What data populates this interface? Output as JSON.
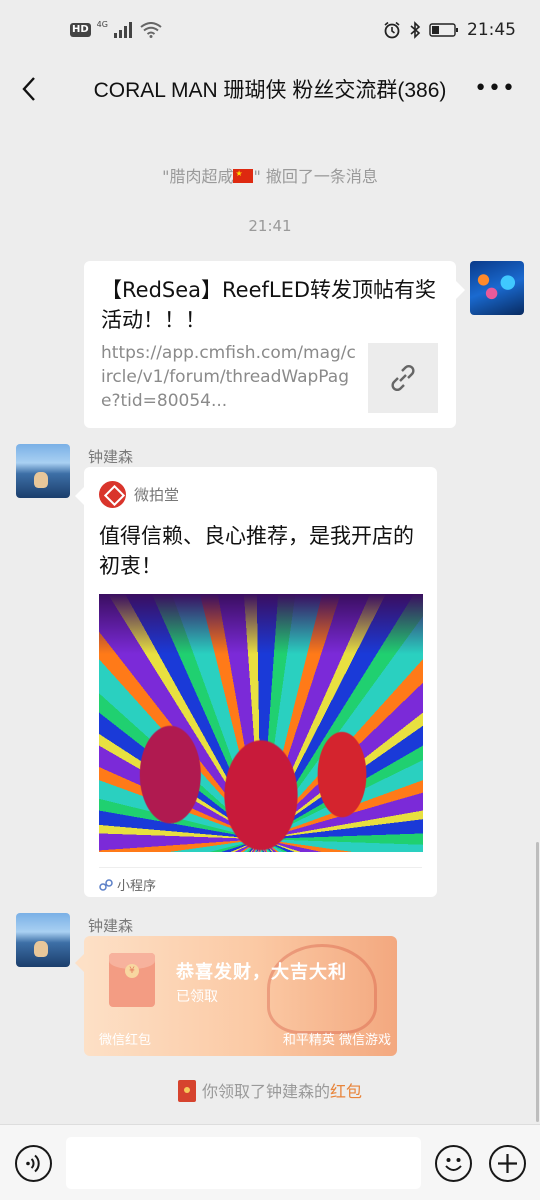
{
  "status_bar": {
    "hd": "HD",
    "network": "4G",
    "time": "21:45"
  },
  "header": {
    "title": "CORAL MAN 珊瑚侠 粉丝交流群(386)",
    "more": "•••"
  },
  "messages": {
    "recall_notice_prefix": "\"腊肉超咸",
    "recall_notice_suffix": "\" 撤回了一条消息",
    "timestamp": "21:41",
    "link_share": {
      "title": "【RedSea】ReefLED转发顶帖有奖活动！！！",
      "url": "https://app.cmfish.com/mag/circle/v1/forum/threadWapPage?tid=80054..."
    },
    "sender_1": "钟建森",
    "mini_program": {
      "app_name": "微拍堂",
      "text": "值得信赖、良心推荐，是我开店的初衷！",
      "footer": "小程序"
    },
    "sender_2": "钟建森",
    "red_packet": {
      "title": "恭喜发财，大吉大利",
      "status": "已领取",
      "brand_left": "微信红包",
      "brand_right": "和平精英 微信游戏"
    },
    "received_notice_prefix": "你领取了钟建森的",
    "received_notice_highlight": "红包"
  },
  "colors": {
    "background": "#ededed",
    "red_packet_orange": "#e8843a",
    "red_packet_bg": "#fbc9a4"
  }
}
